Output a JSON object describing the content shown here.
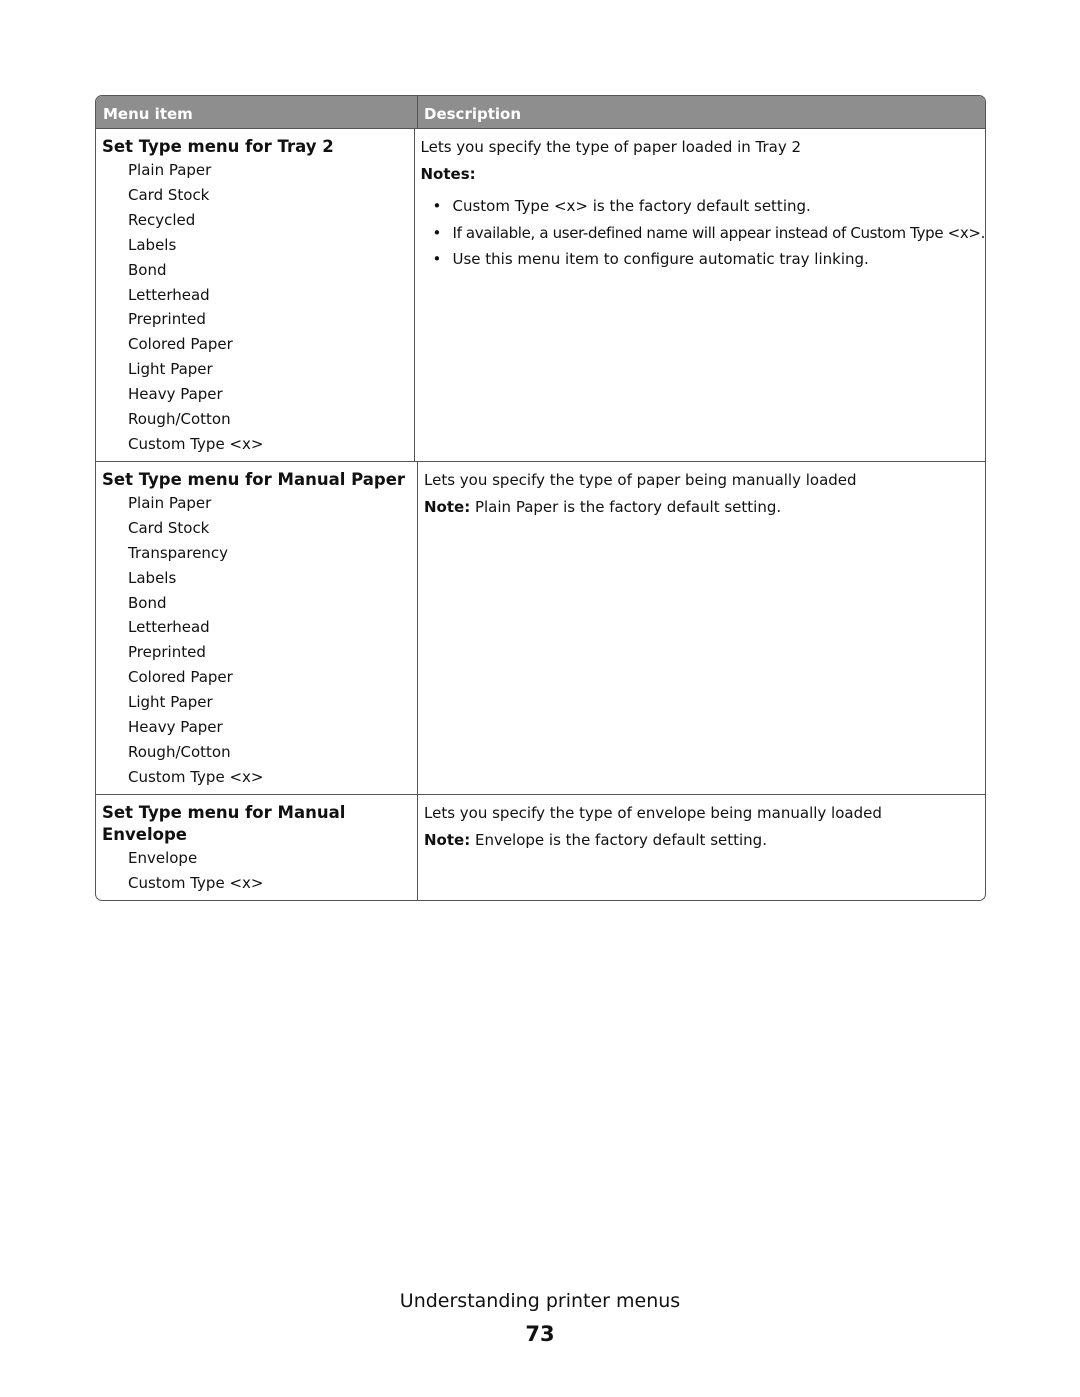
{
  "table": {
    "headers": {
      "menu_item": "Menu item",
      "description": "Description"
    },
    "colors": {
      "header_bg": "#8e8e8e",
      "header_text": "#ffffff",
      "border": "#555555"
    },
    "rows": [
      {
        "title": "Set Type menu for Tray 2",
        "options": [
          "Plain Paper",
          "Card Stock",
          "Recycled",
          "Labels",
          "Bond",
          "Letterhead",
          "Preprinted",
          "Colored Paper",
          "Light Paper",
          "Heavy Paper",
          "Rough/Cotton",
          "Custom Type <x>"
        ],
        "description": "Lets you specify the type of paper loaded in Tray 2",
        "notes_heading": "Notes:",
        "notes": [
          "Custom Type <x> is the factory default setting.",
          "If available, a user-defined name will appear instead of Custom Type <x>.",
          "Use this menu item to configure automatic tray linking."
        ]
      },
      {
        "title": "Set Type menu for Manual Paper",
        "options": [
          "Plain Paper",
          "Card Stock",
          "Transparency",
          "Labels",
          "Bond",
          "Letterhead",
          "Preprinted",
          "Colored Paper",
          "Light Paper",
          "Heavy Paper",
          "Rough/Cotton",
          "Custom Type <x>"
        ],
        "description": "Lets you specify the type of paper being manually loaded",
        "note_label": "Note:",
        "note_text": " Plain Paper is the factory default setting."
      },
      {
        "title": "Set Type menu for Manual Envelope",
        "options": [
          "Envelope",
          "Custom Type <x>"
        ],
        "description": "Lets you specify the type of envelope being manually loaded",
        "note_label": "Note:",
        "note_text": " Envelope is the factory default setting."
      }
    ]
  },
  "footer": {
    "section_title": "Understanding printer menus",
    "page_number": "73"
  }
}
